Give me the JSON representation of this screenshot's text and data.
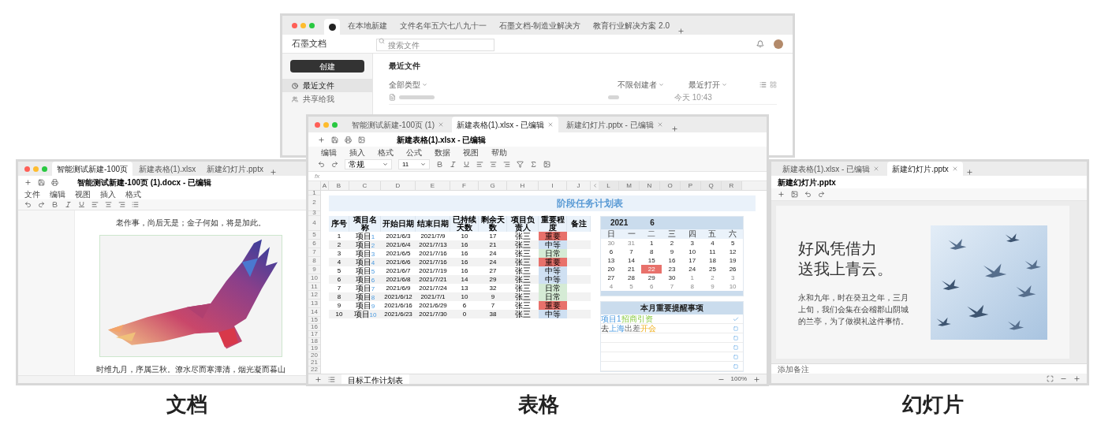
{
  "home_window": {
    "tabs": [
      {
        "label": "在本地新建",
        "selected": false
      },
      {
        "label": "文件名年五六七八九十一",
        "selected": false
      },
      {
        "label": "石墨文档-制造业解决方",
        "selected": false
      },
      {
        "label": "教育行业解决方案 2.0",
        "selected": false
      }
    ],
    "app_name": "石墨文档",
    "search": {
      "placeholder": "搜索文件"
    },
    "create_button": "创建",
    "sidebar": [
      {
        "label": "最近文件",
        "selected": true
      },
      {
        "label": "共享给我",
        "selected": false
      }
    ],
    "section_title": "最近文件",
    "filters": [
      "全部类型",
      "不限创建者",
      "最近打开"
    ],
    "files": [
      {
        "opened": "今天 10:43"
      }
    ]
  },
  "doc_window": {
    "tabs": [
      {
        "label": "智能测试新建-100页",
        "selected": true
      },
      {
        "label": "新建表格(1).xlsx",
        "selected": false
      },
      {
        "label": "新建幻灯片.pptx",
        "selected": false
      }
    ],
    "title": "智能测试新建-100页 (1).docx - 已编辑",
    "menu": [
      "文件",
      "编辑",
      "视图",
      "插入",
      "格式"
    ],
    "lines": [
      "老作事，尚后无是；金子何如，将是加此。"
    ],
    "caption": "时维九月，序属三秋。潦水尽而寒潭清，烟光凝而暮山"
  },
  "sheet_window": {
    "tabs": [
      {
        "label": "智能测试新建-100页 (1)",
        "selected": false
      },
      {
        "label": "新建表格(1).xlsx - 已编辑",
        "selected": true
      },
      {
        "label": "新建幻灯片.pptx - 已编辑",
        "selected": false
      }
    ],
    "title": "新建表格(1).xlsx - 已编辑",
    "menu": [
      "编辑",
      "插入",
      "格式",
      "公式",
      "数据",
      "视图",
      "帮助"
    ],
    "format_select": "常规",
    "font_size": "11",
    "formula_label": "fx",
    "column_letters": [
      "A",
      "B",
      "C",
      "D",
      "E",
      "F",
      "G",
      "H",
      "I",
      "J"
    ],
    "right_column_letters": [
      "L",
      "M",
      "N",
      "O",
      "P",
      "Q",
      "R"
    ],
    "row_numbers": [
      "1",
      "2",
      "3",
      "4",
      "5",
      "6",
      "7",
      "8",
      "9",
      "10",
      "11",
      "12",
      "13",
      "14",
      "15",
      "16",
      "17",
      "18",
      "19",
      "20",
      "21",
      "22"
    ],
    "sheet_title": "阶段任务计划表",
    "table": {
      "columns": [
        "序号",
        "项目名称",
        "开始日期",
        "结束日期",
        "已持续天数",
        "剩余天数",
        "项目负责人",
        "重要程度",
        "备注"
      ],
      "rows": [
        {
          "no": "1",
          "name": "项目",
          "index": "1",
          "start": "2021/6/3",
          "end": "2021/7/9",
          "elapsed": "10",
          "remaining": "17",
          "owner": "张三",
          "importance": "重要",
          "color": "#e8716b"
        },
        {
          "no": "2",
          "name": "项目",
          "index": "2",
          "start": "2021/6/4",
          "end": "2021/7/13",
          "elapsed": "16",
          "remaining": "21",
          "owner": "张三",
          "importance": "中等",
          "color": "#cfe0f2"
        },
        {
          "no": "3",
          "name": "项目",
          "index": "3",
          "start": "2021/6/5",
          "end": "2021/7/16",
          "elapsed": "16",
          "remaining": "24",
          "owner": "张三",
          "importance": "日常",
          "color": "#d5ebd5"
        },
        {
          "no": "4",
          "name": "项目",
          "index": "4",
          "start": "2021/6/6",
          "end": "2021/7/16",
          "elapsed": "16",
          "remaining": "24",
          "owner": "张三",
          "importance": "重要",
          "color": "#e8716b"
        },
        {
          "no": "5",
          "name": "项目",
          "index": "5",
          "start": "2021/6/7",
          "end": "2021/7/19",
          "elapsed": "16",
          "remaining": "27",
          "owner": "张三",
          "importance": "中等",
          "color": "#cfe0f2"
        },
        {
          "no": "6",
          "name": "项目",
          "index": "6",
          "start": "2021/6/8",
          "end": "2021/7/21",
          "elapsed": "14",
          "remaining": "29",
          "owner": "张三",
          "importance": "中等",
          "color": "#cfe0f2"
        },
        {
          "no": "7",
          "name": "项目",
          "index": "7",
          "start": "2021/6/9",
          "end": "2021/7/24",
          "elapsed": "13",
          "remaining": "32",
          "owner": "张三",
          "importance": "日常",
          "color": "#d5ebd5"
        },
        {
          "no": "8",
          "name": "项目",
          "index": "8",
          "start": "2021/6/12",
          "end": "2021/7/1",
          "elapsed": "10",
          "remaining": "9",
          "owner": "张三",
          "importance": "日常",
          "color": "#d5ebd5"
        },
        {
          "no": "9",
          "name": "项目",
          "index": "9",
          "start": "2021/6/16",
          "end": "2021/6/29",
          "elapsed": "6",
          "remaining": "7",
          "owner": "张三",
          "importance": "重要",
          "color": "#e8716b"
        },
        {
          "no": "10",
          "name": "项目",
          "index": "10",
          "start": "2021/6/23",
          "end": "2021/7/30",
          "elapsed": "0",
          "remaining": "38",
          "owner": "张三",
          "importance": "中等",
          "color": "#cfe0f2"
        }
      ]
    },
    "calendar": {
      "year": "2021",
      "month": "6",
      "weekdays": [
        "日",
        "一",
        "二",
        "三",
        "四",
        "五",
        "六"
      ],
      "days": [
        {
          "d": "30",
          "muted": true,
          "selected": false
        },
        {
          "d": "31",
          "muted": true,
          "selected": false
        },
        {
          "d": "1",
          "muted": false,
          "selected": false
        },
        {
          "d": "2",
          "muted": false,
          "selected": false
        },
        {
          "d": "3",
          "muted": false,
          "selected": false
        },
        {
          "d": "4",
          "muted": false,
          "selected": false
        },
        {
          "d": "5",
          "muted": false,
          "selected": false
        },
        {
          "d": "6",
          "muted": false,
          "selected": false
        },
        {
          "d": "7",
          "muted": false,
          "selected": false
        },
        {
          "d": "8",
          "muted": false,
          "selected": false
        },
        {
          "d": "9",
          "muted": false,
          "selected": false
        },
        {
          "d": "10",
          "muted": false,
          "selected": false
        },
        {
          "d": "11",
          "muted": false,
          "selected": false
        },
        {
          "d": "12",
          "muted": false,
          "selected": false
        },
        {
          "d": "13",
          "muted": false,
          "selected": false
        },
        {
          "d": "14",
          "muted": false,
          "selected": false
        },
        {
          "d": "15",
          "muted": false,
          "selected": false
        },
        {
          "d": "16",
          "muted": false,
          "selected": false
        },
        {
          "d": "17",
          "muted": false,
          "selected": false
        },
        {
          "d": "18",
          "muted": false,
          "selected": false
        },
        {
          "d": "19",
          "muted": false,
          "selected": false
        },
        {
          "d": "20",
          "muted": false,
          "selected": false
        },
        {
          "d": "21",
          "muted": false,
          "selected": false
        },
        {
          "d": "22",
          "muted": false,
          "selected": true
        },
        {
          "d": "23",
          "muted": false,
          "selected": false
        },
        {
          "d": "24",
          "muted": false,
          "selected": false
        },
        {
          "d": "25",
          "muted": false,
          "selected": false
        },
        {
          "d": "26",
          "muted": false,
          "selected": false
        },
        {
          "d": "27",
          "muted": false,
          "selected": false
        },
        {
          "d": "28",
          "muted": false,
          "selected": false
        },
        {
          "d": "29",
          "muted": false,
          "selected": false
        },
        {
          "d": "30",
          "muted": false,
          "selected": false
        },
        {
          "d": "1",
          "muted": true,
          "selected": false
        },
        {
          "d": "2",
          "muted": true,
          "selected": false
        },
        {
          "d": "3",
          "muted": true,
          "selected": false
        },
        {
          "d": "4",
          "muted": true,
          "selected": false
        },
        {
          "d": "5",
          "muted": true,
          "selected": false
        },
        {
          "d": "6",
          "muted": true,
          "selected": false
        },
        {
          "d": "7",
          "muted": true,
          "selected": false
        },
        {
          "d": "8",
          "muted": true,
          "selected": false
        },
        {
          "d": "9",
          "muted": true,
          "selected": false
        },
        {
          "d": "10",
          "muted": true,
          "selected": false
        }
      ]
    },
    "todo": {
      "title": "本月重要提醒事项",
      "items": [
        {
          "segments": [
            {
              "text": "项目1",
              "kind": "subject"
            },
            {
              "text": "招商引资",
              "kind": "task"
            }
          ],
          "checked": true
        },
        {
          "segments": [
            {
              "text": "去",
              "kind": "plain"
            },
            {
              "text": "上海",
              "kind": "subject"
            },
            {
              "text": "出差",
              "kind": "muted"
            },
            {
              "text": "开会",
              "kind": "event"
            }
          ],
          "checked": false
        },
        {
          "checked": false
        },
        {
          "checked": false
        },
        {
          "checked": false
        },
        {
          "checked": false
        }
      ]
    },
    "sheet_tab": "目标工作计划表",
    "zoom": "100%"
  },
  "slide_window": {
    "tabs": [
      {
        "label": "新建表格(1).xlsx - 已编辑",
        "selected": false
      },
      {
        "label": "新建幻灯片.pptx",
        "selected": true
      }
    ],
    "title": "新建幻灯片.pptx",
    "heading": [
      "好风凭借力",
      "送我上青云。"
    ],
    "body": "永和九年，时在癸丑之年，三月上旬，我们会集在会稽郡山阴城的兰亭，为了做禊礼这件事情。",
    "notes": "添加备注"
  },
  "captions": [
    "文档",
    "表格",
    "幻灯片"
  ]
}
